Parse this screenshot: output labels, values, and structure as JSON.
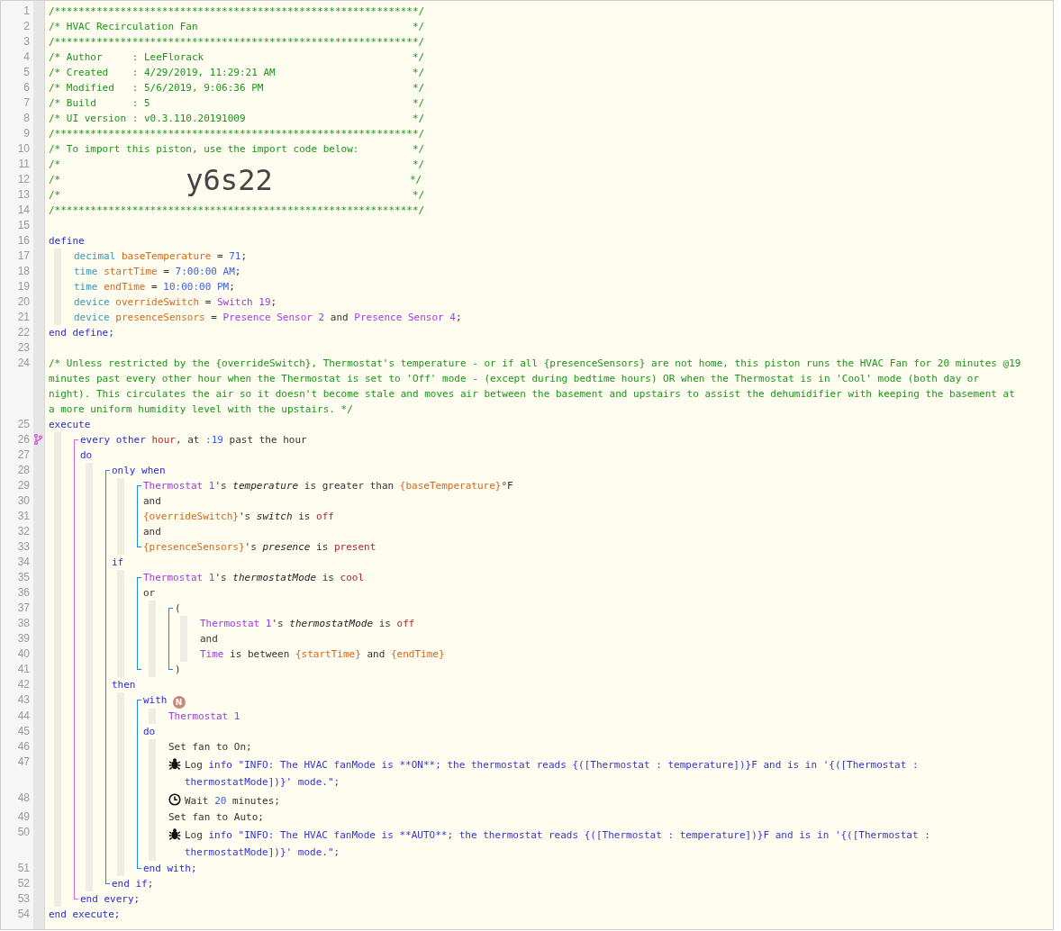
{
  "listing": [
    {
      "kind": "line",
      "number": "1",
      "tokens": [
        {
          "kind": "comment",
          "text": "/*************************************************************/"
        }
      ]
    },
    {
      "kind": "line",
      "number": "2",
      "tokens": [
        {
          "kind": "comment",
          "text": "/* HVAC Recirculation Fan                                    */"
        }
      ]
    },
    {
      "kind": "line",
      "number": "3",
      "tokens": [
        {
          "kind": "comment",
          "text": "/*************************************************************/"
        }
      ]
    },
    {
      "kind": "line",
      "number": "4",
      "tokens": [
        {
          "kind": "comment",
          "text": "/* Author     : LeeFlorack                                   */"
        }
      ]
    },
    {
      "kind": "line",
      "number": "5",
      "tokens": [
        {
          "kind": "comment",
          "text": "/* Created    : 4/29/2019, 11:29:21 AM                       */"
        }
      ]
    },
    {
      "kind": "line",
      "number": "6",
      "tokens": [
        {
          "kind": "comment",
          "text": "/* Modified   : 5/6/2019, 9:06:36 PM                         */"
        }
      ]
    },
    {
      "kind": "line",
      "number": "7",
      "tokens": [
        {
          "kind": "comment",
          "text": "/* Build      : 5                                            */"
        }
      ]
    },
    {
      "kind": "line",
      "number": "8",
      "tokens": [
        {
          "kind": "comment",
          "text": "/* UI version : v0.3.110.20191009                            */"
        }
      ]
    },
    {
      "kind": "line",
      "number": "9",
      "tokens": [
        {
          "kind": "comment",
          "text": "/*************************************************************/"
        }
      ]
    },
    {
      "kind": "line",
      "number": "10",
      "tokens": [
        {
          "kind": "comment",
          "text": "/* To import this piston, use the import code below:         */"
        }
      ]
    },
    {
      "kind": "line",
      "number": "11",
      "tokens": [
        {
          "kind": "comment",
          "text": "/*                                                           */"
        }
      ]
    },
    {
      "kind": "line",
      "number": "12",
      "tokens": [
        {
          "kind": "comment",
          "text": "/*                     "
        },
        {
          "kind": "import_code",
          "text": "y6s22"
        },
        {
          "kind": "comment",
          "text": "                       */"
        }
      ]
    },
    {
      "kind": "line",
      "number": "13",
      "tokens": [
        {
          "kind": "comment",
          "text": "/*                                                           */"
        }
      ]
    },
    {
      "kind": "line",
      "number": "14",
      "tokens": [
        {
          "kind": "comment",
          "text": "/*************************************************************/"
        }
      ]
    },
    {
      "kind": "line",
      "number": "15"
    },
    {
      "kind": "line",
      "number": "16",
      "tokens": [
        {
          "kind": "keyword",
          "text": "define"
        }
      ]
    },
    {
      "kind": "indent",
      "children": [
        {
          "kind": "line",
          "number": "17",
          "tokens": [
            {
              "kind": "type",
              "text": "decimal "
            },
            {
              "kind": "variable",
              "text": "baseTemperature"
            },
            {
              "kind": "plain",
              "text": " = "
            },
            {
              "kind": "number",
              "text": "71"
            },
            {
              "kind": "plain",
              "text": ";"
            }
          ]
        },
        {
          "kind": "line",
          "number": "18",
          "tokens": [
            {
              "kind": "type",
              "text": "time "
            },
            {
              "kind": "variable",
              "text": "startTime"
            },
            {
              "kind": "plain",
              "text": " = "
            },
            {
              "kind": "number",
              "text": "7:00:00 AM"
            },
            {
              "kind": "plain",
              "text": ";"
            }
          ]
        },
        {
          "kind": "line",
          "number": "19",
          "tokens": [
            {
              "kind": "type",
              "text": "time "
            },
            {
              "kind": "variable",
              "text": "endTime"
            },
            {
              "kind": "plain",
              "text": " = "
            },
            {
              "kind": "number",
              "text": "10:00:00 PM"
            },
            {
              "kind": "plain",
              "text": ";"
            }
          ]
        },
        {
          "kind": "line",
          "number": "20",
          "tokens": [
            {
              "kind": "type",
              "text": "device "
            },
            {
              "kind": "variable",
              "text": "overrideSwitch"
            },
            {
              "kind": "plain",
              "text": " = "
            },
            {
              "kind": "device",
              "text": "Switch 19"
            },
            {
              "kind": "plain",
              "text": ";"
            }
          ]
        },
        {
          "kind": "line",
          "number": "21",
          "tokens": [
            {
              "kind": "type",
              "text": "device "
            },
            {
              "kind": "variable",
              "text": "presenceSensors"
            },
            {
              "kind": "plain",
              "text": " = "
            },
            {
              "kind": "device",
              "text": "Presence Sensor 2"
            },
            {
              "kind": "plain",
              "text": " and "
            },
            {
              "kind": "device",
              "text": "Presence Sensor 4"
            },
            {
              "kind": "plain",
              "text": ";"
            }
          ]
        }
      ]
    },
    {
      "kind": "line",
      "number": "22",
      "tokens": [
        {
          "kind": "keyword",
          "text": "end define;"
        }
      ]
    },
    {
      "kind": "line",
      "number": "23"
    },
    {
      "kind": "line",
      "number": "24",
      "tokens": [
        {
          "kind": "comment",
          "text": "/* Unless restricted by the {overrideSwitch}, Thermostat's temperature - or if all {presenceSensors} are not home, this piston runs the HVAC Fan for 20 minutes @19 minutes past every other hour when the Thermostat is set to 'Off' mode - (except during bedtime hours) OR when the Thermostat is in 'Cool' mode (both day or night). This circulates the air so it doesn't become stale and moves air between the basement and upstairs to assist the dehumidifier with keeping the basement at a more uniform humidity level with the upstairs. */"
        }
      ]
    },
    {
      "kind": "line",
      "number": "25",
      "tokens": [
        {
          "kind": "keyword",
          "text": "execute"
        }
      ]
    },
    {
      "kind": "indent",
      "children": [
        {
          "kind": "group",
          "color": "#dd66dd",
          "children": [
            {
              "kind": "line",
              "number": "26",
              "trigger": true,
              "tokens": [
                {
                  "kind": "keyword",
                  "text": "every other "
                },
                {
                  "kind": "value",
                  "text": "hour,"
                },
                {
                  "kind": "plain",
                  "text": " at "
                },
                {
                  "kind": "number",
                  "text": ":19"
                },
                {
                  "kind": "plain",
                  "text": " past the hour"
                }
              ]
            },
            {
              "kind": "line",
              "number": "27",
              "tokens": [
                {
                  "kind": "keyword",
                  "text": "do"
                }
              ]
            },
            {
              "kind": "indent",
              "children": [
                {
                  "kind": "group",
                  "color": "#1e88e5",
                  "children": [
                    {
                      "kind": "line",
                      "number": "28",
                      "tokens": [
                        {
                          "kind": "keyword",
                          "text": "only when"
                        }
                      ]
                    },
                    {
                      "kind": "indent",
                      "children": [
                        {
                          "kind": "group",
                          "color": "#1e88e5",
                          "children": [
                            {
                              "kind": "line",
                              "number": "29",
                              "tokens": [
                                {
                                  "kind": "device",
                                  "text": "Thermostat 1"
                                },
                                {
                                  "kind": "plain",
                                  "text": "'s "
                                },
                                {
                                  "kind": "attribute",
                                  "text": "temperature"
                                },
                                {
                                  "kind": "plain",
                                  "text": " is greater than "
                                },
                                {
                                  "kind": "variable",
                                  "text": "{baseTemperature}"
                                },
                                {
                                  "kind": "plain",
                                  "text": "°F"
                                }
                              ]
                            },
                            {
                              "kind": "line",
                              "number": "30",
                              "tokens": [
                                {
                                  "kind": "plain",
                                  "text": "and"
                                }
                              ]
                            },
                            {
                              "kind": "line",
                              "number": "31",
                              "tokens": [
                                {
                                  "kind": "variable",
                                  "text": "{overrideSwitch}"
                                },
                                {
                                  "kind": "plain",
                                  "text": "'s "
                                },
                                {
                                  "kind": "attribute",
                                  "text": "switch"
                                },
                                {
                                  "kind": "plain",
                                  "text": " is "
                                },
                                {
                                  "kind": "value",
                                  "text": "off"
                                }
                              ]
                            },
                            {
                              "kind": "line",
                              "number": "32",
                              "tokens": [
                                {
                                  "kind": "plain",
                                  "text": "and"
                                }
                              ]
                            },
                            {
                              "kind": "line",
                              "number": "33",
                              "tokens": [
                                {
                                  "kind": "variable",
                                  "text": "{presenceSensors}"
                                },
                                {
                                  "kind": "plain",
                                  "text": "'s "
                                },
                                {
                                  "kind": "attribute",
                                  "text": "presence"
                                },
                                {
                                  "kind": "plain",
                                  "text": " is "
                                },
                                {
                                  "kind": "value",
                                  "text": "present"
                                }
                              ]
                            }
                          ]
                        }
                      ]
                    },
                    {
                      "kind": "line",
                      "number": "34",
                      "tokens": [
                        {
                          "kind": "keyword",
                          "text": "if"
                        }
                      ]
                    },
                    {
                      "kind": "indent",
                      "children": [
                        {
                          "kind": "group",
                          "color": "#1e88e5",
                          "children": [
                            {
                              "kind": "line",
                              "number": "35",
                              "tokens": [
                                {
                                  "kind": "device",
                                  "text": "Thermostat 1"
                                },
                                {
                                  "kind": "plain",
                                  "text": "'s "
                                },
                                {
                                  "kind": "attribute",
                                  "text": "thermostatMode"
                                },
                                {
                                  "kind": "plain",
                                  "text": " is "
                                },
                                {
                                  "kind": "value",
                                  "text": "cool"
                                }
                              ]
                            },
                            {
                              "kind": "line",
                              "number": "36",
                              "tokens": [
                                {
                                  "kind": "plain",
                                  "text": "or"
                                }
                              ]
                            },
                            {
                              "kind": "indent",
                              "children": [
                                {
                                  "kind": "group",
                                  "color": "#1e88e5",
                                  "children": [
                                    {
                                      "kind": "line",
                                      "number": "37",
                                      "tokens": [
                                        {
                                          "kind": "plain",
                                          "text": "("
                                        }
                                      ]
                                    },
                                    {
                                      "kind": "indent",
                                      "children": [
                                        {
                                          "kind": "line",
                                          "number": "38",
                                          "tokens": [
                                            {
                                              "kind": "device",
                                              "text": "Thermostat 1"
                                            },
                                            {
                                              "kind": "plain",
                                              "text": "'s "
                                            },
                                            {
                                              "kind": "attribute",
                                              "text": "thermostatMode"
                                            },
                                            {
                                              "kind": "plain",
                                              "text": " is "
                                            },
                                            {
                                              "kind": "value",
                                              "text": "off"
                                            }
                                          ]
                                        },
                                        {
                                          "kind": "line",
                                          "number": "39",
                                          "tokens": [
                                            {
                                              "kind": "plain",
                                              "text": "and"
                                            }
                                          ]
                                        },
                                        {
                                          "kind": "line",
                                          "number": "40",
                                          "tokens": [
                                            {
                                              "kind": "device",
                                              "text": "Time"
                                            },
                                            {
                                              "kind": "plain",
                                              "text": " is between "
                                            },
                                            {
                                              "kind": "variable",
                                              "text": "{startTime}"
                                            },
                                            {
                                              "kind": "plain",
                                              "text": " and "
                                            },
                                            {
                                              "kind": "variable",
                                              "text": "{endTime}"
                                            }
                                          ]
                                        }
                                      ]
                                    },
                                    {
                                      "kind": "line",
                                      "number": "41",
                                      "tokens": [
                                        {
                                          "kind": "plain",
                                          "text": ")"
                                        }
                                      ]
                                    }
                                  ]
                                }
                              ]
                            }
                          ]
                        }
                      ]
                    },
                    {
                      "kind": "line",
                      "number": "42",
                      "tokens": [
                        {
                          "kind": "keyword",
                          "text": "then"
                        }
                      ]
                    },
                    {
                      "kind": "indent",
                      "children": [
                        {
                          "kind": "group",
                          "color": "#1e88e5",
                          "children": [
                            {
                              "kind": "line",
                              "number": "43",
                              "badge": "N",
                              "tokens": [
                                {
                                  "kind": "keyword",
                                  "text": "with"
                                }
                              ]
                            },
                            {
                              "kind": "indent",
                              "children": [
                                {
                                  "kind": "line",
                                  "number": "44",
                                  "tokens": [
                                    {
                                      "kind": "device",
                                      "text": "Thermostat 1"
                                    }
                                  ]
                                }
                              ]
                            },
                            {
                              "kind": "line",
                              "number": "45",
                              "tokens": [
                                {
                                  "kind": "keyword",
                                  "text": "do"
                                }
                              ]
                            },
                            {
                              "kind": "indent",
                              "children": [
                                {
                                  "kind": "line",
                                  "number": "46",
                                  "tokens": [
                                    {
                                      "kind": "plain",
                                      "text": "Set fan to On;"
                                    }
                                  ]
                                },
                                {
                                  "kind": "log_line",
                                  "number": "47",
                                  "tokens": [
                                    {
                                      "kind": "plain",
                                      "text": "Log "
                                    },
                                    {
                                      "kind": "keyword",
                                      "text": "info"
                                    },
                                    {
                                      "kind": "string",
                                      "text": " \"INFO: The HVAC fanMode is **ON**; the thermostat reads {([Thermostat : temperature])}F and is in '{([Thermostat : thermostatMode])}' mode.\";"
                                    }
                                  ]
                                },
                                {
                                  "kind": "wait_line",
                                  "number": "48",
                                  "tokens": [
                                    {
                                      "kind": "plain",
                                      "text": "Wait "
                                    },
                                    {
                                      "kind": "number",
                                      "text": "20"
                                    },
                                    {
                                      "kind": "plain",
                                      "text": " minutes;"
                                    }
                                  ]
                                },
                                {
                                  "kind": "line",
                                  "number": "49",
                                  "tokens": [
                                    {
                                      "kind": "plain",
                                      "text": "Set fan to Auto;"
                                    }
                                  ]
                                },
                                {
                                  "kind": "log_line",
                                  "number": "50",
                                  "tokens": [
                                    {
                                      "kind": "plain",
                                      "text": "Log "
                                    },
                                    {
                                      "kind": "keyword",
                                      "text": "info"
                                    },
                                    {
                                      "kind": "string",
                                      "text": " \"INFO: The HVAC fanMode is **AUTO**; the thermostat reads {([Thermostat : temperature])}F and is in '{([Thermostat : thermostatMode])}' mode.\";"
                                    }
                                  ]
                                }
                              ]
                            },
                            {
                              "kind": "line",
                              "number": "51",
                              "tokens": [
                                {
                                  "kind": "keyword",
                                  "text": "end with;"
                                }
                              ]
                            }
                          ]
                        }
                      ]
                    },
                    {
                      "kind": "line",
                      "number": "52",
                      "tokens": [
                        {
                          "kind": "keyword",
                          "text": "end if;"
                        }
                      ]
                    }
                  ]
                }
              ]
            },
            {
              "kind": "line",
              "number": "53",
              "tokens": [
                {
                  "kind": "keyword",
                  "text": "end every;"
                }
              ]
            }
          ]
        }
      ]
    },
    {
      "kind": "line",
      "number": "54",
      "tokens": [
        {
          "kind": "keyword",
          "text": "end execute;"
        }
      ]
    }
  ]
}
